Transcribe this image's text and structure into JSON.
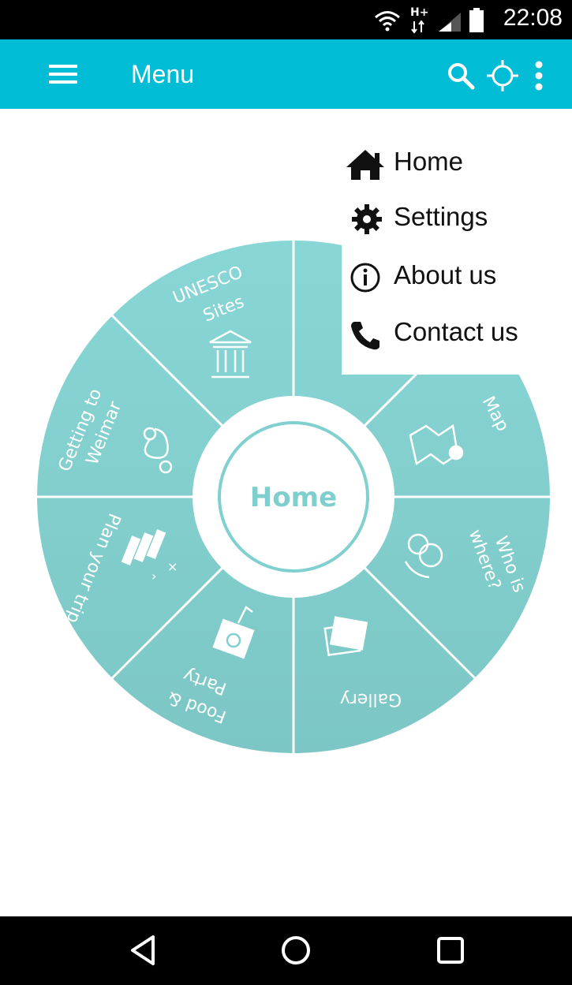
{
  "status_bar": {
    "time": "22:08",
    "network": "H+"
  },
  "app_bar": {
    "title": "Menu"
  },
  "wheel": {
    "center_label": "Home",
    "segments": [
      {
        "line1": "UNESCO",
        "line2": "Sites"
      },
      {
        "line1": "Map",
        "line2": ""
      },
      {
        "line1": "Who is",
        "line2": "where?"
      },
      {
        "line1": "Gallery",
        "line2": ""
      },
      {
        "line1": "Food &",
        "line2": "Party"
      },
      {
        "line1": "Plan your trip",
        "line2": ""
      },
      {
        "line1": "Getting to",
        "line2": "Weimar"
      }
    ]
  },
  "overflow_menu": {
    "items": [
      {
        "label": "Home",
        "icon": "home-icon"
      },
      {
        "label": "Settings",
        "icon": "gear-icon"
      },
      {
        "label": "About us",
        "icon": "info-icon"
      },
      {
        "label": "Contact us",
        "icon": "phone-icon"
      }
    ]
  },
  "colors": {
    "app_bar": "#00bcd4",
    "wheel_fill": "#80d0d0",
    "wheel_center_text": "#7fcfcf",
    "status_bar": "#000000"
  }
}
